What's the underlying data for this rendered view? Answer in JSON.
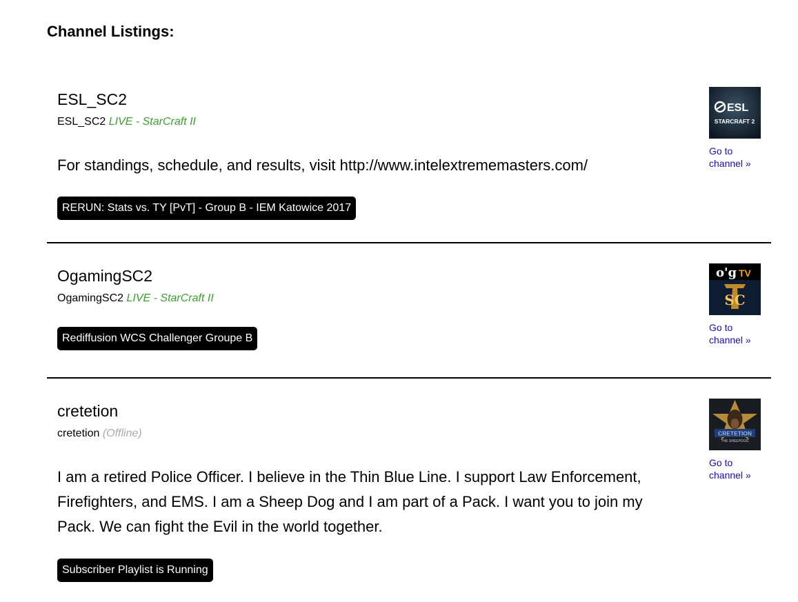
{
  "page": {
    "heading": "Channel Listings:"
  },
  "channels": [
    {
      "name": "ESL_SC2",
      "sub_name": "ESL_SC2",
      "status": "LIVE - StarCraft II",
      "description": "For standings, schedule, and results, visit http://www.intelextrememasters.com/",
      "badge": "RERUN: Stats vs. TY [PvT] - Group B - IEM Katowice 2017",
      "link": "Go to channel »",
      "thumb_brand": "ESL",
      "thumb_caption": "STARCRAFT 2"
    },
    {
      "name": "OgamingSC2",
      "sub_name": "OgamingSC2",
      "status": "LIVE - StarCraft II",
      "badge": "Rediffusion WCS Challenger Groupe B",
      "link": "Go to channel »",
      "thumb_brand": "o'g",
      "thumb_brand_tv": "TV",
      "thumb_caption": "SC"
    },
    {
      "name": "cretetion",
      "sub_name": "cretetion",
      "status": "(Offline)",
      "description": "I am a retired Police Officer. I believe in the Thin Blue Line. I support Law Enforcement, Firefighters, and EMS. I am a Sheep Dog and I am part of a Pack. I want you to join my Pack. We can fight the Evil in the world together.",
      "badge": "Subscriber Playlist is Running",
      "link": "Go to channel »",
      "thumb_brand": "CRETETION",
      "thumb_caption": "THE SHEEPDOG"
    }
  ],
  "colors": {
    "live": "#3aa02d",
    "offline": "#a8a8a8",
    "link": "#1a0dab",
    "badge_bg": "#000000"
  }
}
